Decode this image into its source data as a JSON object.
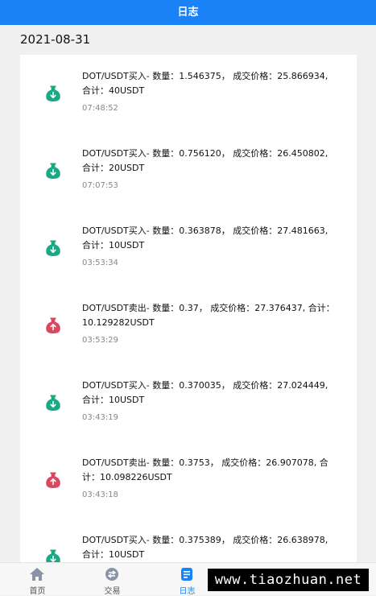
{
  "header": {
    "title": "日志"
  },
  "date_heading": "2021-08-31",
  "entries": [
    {
      "type": "buy",
      "icon": "money-bag-down-icon",
      "text": "DOT/USDT买入- 数量：1.546375， 成交价格：25.866934, 合计：40USDT",
      "time": "07:48:52"
    },
    {
      "type": "buy",
      "icon": "money-bag-down-icon",
      "text": "DOT/USDT买入- 数量：0.756120， 成交价格：26.450802, 合计：20USDT",
      "time": "07:07:53"
    },
    {
      "type": "buy",
      "icon": "money-bag-down-icon",
      "text": "DOT/USDT买入- 数量：0.363878， 成交价格：27.481663, 合计：10USDT",
      "time": "03:53:34"
    },
    {
      "type": "sell",
      "icon": "money-bag-up-icon",
      "text": "DOT/USDT卖出- 数量：0.37， 成交价格：27.376437, 合计：10.129282USDT",
      "time": "03:53:29"
    },
    {
      "type": "buy",
      "icon": "money-bag-down-icon",
      "text": "DOT/USDT买入- 数量：0.370035， 成交价格：27.024449, 合计：10USDT",
      "time": "03:43:19"
    },
    {
      "type": "sell",
      "icon": "money-bag-up-icon",
      "text": "DOT/USDT卖出- 数量：0.3753， 成交价格：26.907078, 合计：10.098226USDT",
      "time": "03:43:18"
    },
    {
      "type": "buy",
      "icon": "money-bag-down-icon",
      "text": "DOT/USDT买入- 数量：0.375389， 成交价格：26.638978, 合计：10USDT",
      "time": ""
    }
  ],
  "colors": {
    "buy": "#1aa886",
    "sell": "#d9485f",
    "accent": "#1a82f7"
  },
  "tabs": [
    {
      "label": "首页",
      "icon": "home-icon",
      "active": false
    },
    {
      "label": "交易",
      "icon": "exchange-icon",
      "active": false
    },
    {
      "label": "日志",
      "icon": "log-icon",
      "active": true
    },
    {
      "label": "",
      "icon": "assets-icon",
      "active": false
    },
    {
      "label": "",
      "icon": "profile-icon",
      "active": false
    }
  ],
  "watermark": "www.tiaozhuan.net"
}
